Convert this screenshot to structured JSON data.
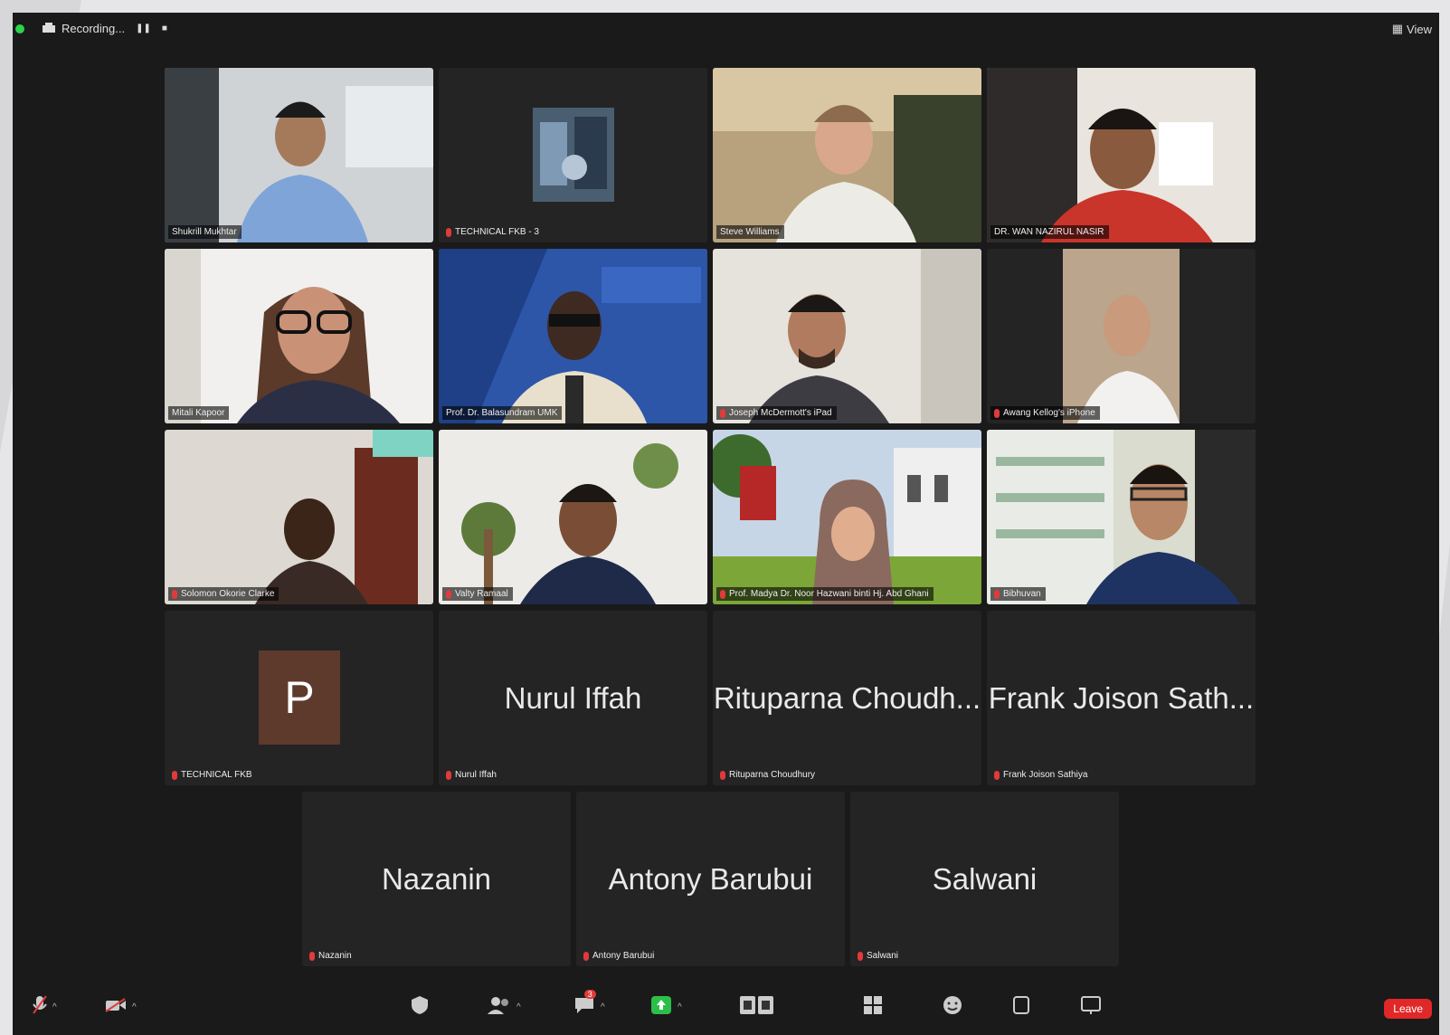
{
  "window": {
    "recording_label": "Recording...",
    "view_label": "View"
  },
  "tiles_row1": [
    {
      "label": "Shukrill Mukhtar",
      "muted": false
    },
    {
      "label": "TECHNICAL FKB - 3",
      "muted": true
    },
    {
      "label": "Steve Williams",
      "muted": false
    },
    {
      "label": "DR. WAN NAZIRUL NASIR",
      "muted": false
    }
  ],
  "tiles_row2": [
    {
      "label": "Mitali Kapoor",
      "muted": false
    },
    {
      "label": "Prof. Dr. Balasundram UMK",
      "muted": false
    },
    {
      "label": "Joseph McDermott's iPad",
      "muted": true
    },
    {
      "label": "Awang Kellog's iPhone",
      "muted": true
    }
  ],
  "tiles_row3": [
    {
      "label": "Solomon Okorie Clarke",
      "muted": true
    },
    {
      "label": "Valty Ramaal",
      "muted": true
    },
    {
      "label": "Prof. Madya Dr. Noor Hazwani binti Hj. Abd Ghani",
      "muted": true
    },
    {
      "label": "Bibhuvan",
      "muted": true
    }
  ],
  "tiles_row4": [
    {
      "title": "",
      "avatar": "P",
      "label": "TECHNICAL FKB"
    },
    {
      "title": "Nurul Iffah",
      "label": "Nurul Iffah"
    },
    {
      "title": "Rituparna Choudh...",
      "label": "Rituparna Choudhury"
    },
    {
      "title": "Frank Joison Sath...",
      "label": "Frank Joison Sathiya"
    }
  ],
  "tiles_row5": [
    {
      "title": "Nazanin",
      "label": "Nazanin"
    },
    {
      "title": "Antony Barubui",
      "label": "Antony Barubui"
    },
    {
      "title": "Salwani",
      "label": "Salwani"
    }
  ],
  "toolbar": {
    "leave_label": "Leave",
    "chat_badge": "3"
  },
  "colors": {
    "active_speaker": "#38b24a",
    "mute_red": "#e03a3a",
    "leave_red": "#e02828"
  }
}
